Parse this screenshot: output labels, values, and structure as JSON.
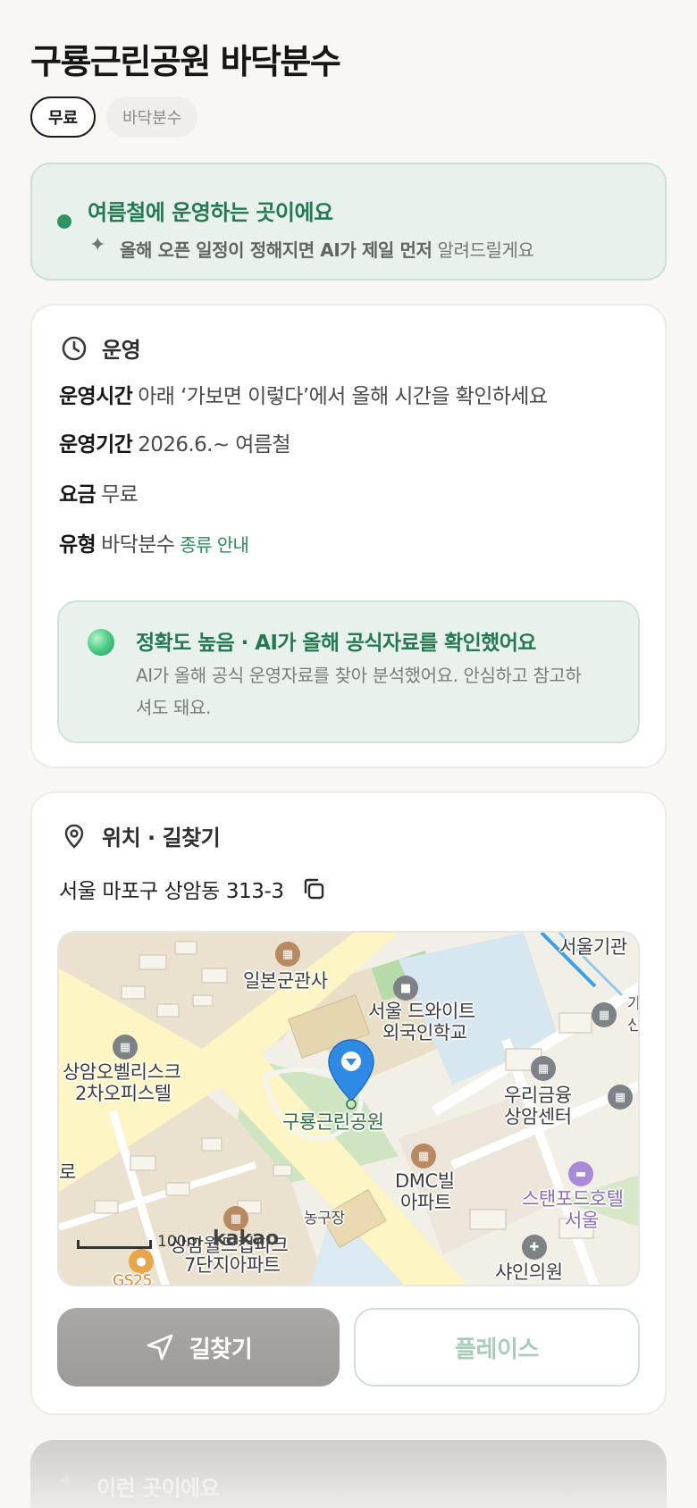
{
  "page": {
    "title": "구룡근린공원 바닥분수",
    "chips": [
      "무료",
      "바닥분수"
    ]
  },
  "season_banner": {
    "title": "여름철에 운영하는 곳이에요",
    "note_bold": "올해 오픈 일정이 정해지면 AI가 제일 먼저",
    "note_rest": "알려드릴게요",
    "accent": "#2e9466"
  },
  "operation": {
    "header": "운영",
    "rows": [
      {
        "key": "운영시간",
        "value": "아래 ‘가보면 이렇다’에서 올해 시간을 확인하세요"
      },
      {
        "key": "운영기간",
        "value": "2026.6.~ 여름철"
      },
      {
        "key": "요금",
        "value": "무료"
      },
      {
        "key": "유형",
        "value": "바닥분수",
        "link": "종류 안내"
      }
    ],
    "accuracy": {
      "title": "정확도 높음 · AI가 올해 공식자료를 확인했어요",
      "text": "AI가 올해 공식 운영자료를 찾아 분석했어요. 안심하고 참고하셔도 돼요."
    }
  },
  "location": {
    "header": "위치 · 길찾기",
    "address": "서울 마포구 상암동 313-3",
    "map": {
      "pois": {
        "ilbon": "일본군관사",
        "dwight_1": "서울 드와이트",
        "dwight_2": "외국인학교",
        "obelisk_1": "상암오벨리스크",
        "obelisk_2": "2차오피스텔",
        "park": "구룡근린공원",
        "woori_1": "우리금융",
        "woori_2": "상암센터",
        "dmc_1": "DMC빌",
        "dmc_2": "아파트",
        "stanford_1": "스탠포드호텔",
        "stanford_2": "서울",
        "court": "농구장",
        "worldcup_1": "상암월드컵파크",
        "worldcup_2": "7단지아파트",
        "clinic": "샤인의원",
        "seoul_inst": "서울기관",
        "road": "로",
        "gs": "GS25",
        "edge_1": "가",
        "edge_2": "신"
      },
      "scale": "100m",
      "logo": "kakao",
      "pin_color": "#2f8ae5"
    },
    "buttons": {
      "navigate": "길찾기",
      "place": "플레이스"
    }
  },
  "next_section": {
    "title": "이런 곳이에요"
  }
}
